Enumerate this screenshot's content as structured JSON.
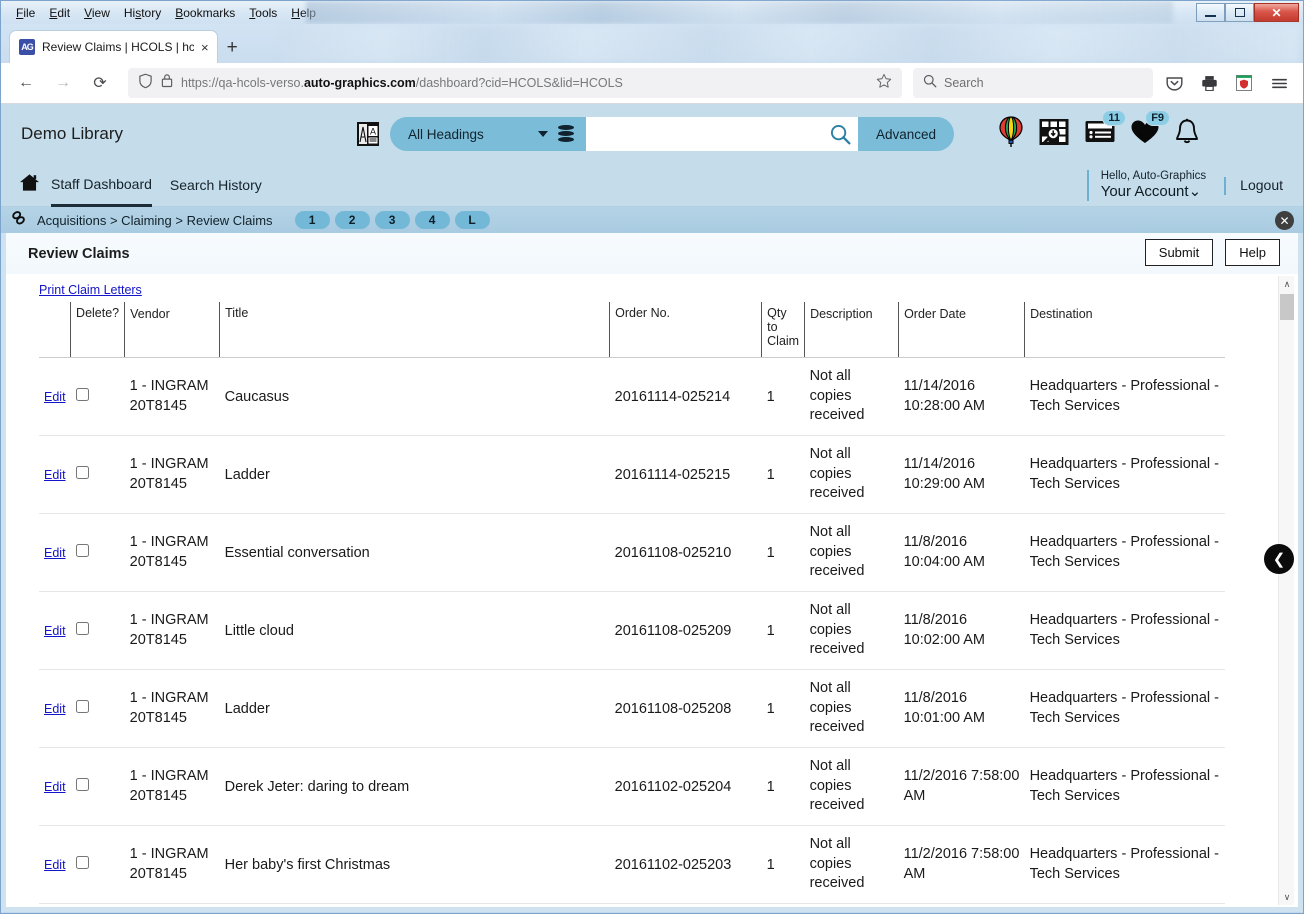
{
  "browser": {
    "menus": [
      "File",
      "Edit",
      "View",
      "History",
      "Bookmarks",
      "Tools",
      "Help"
    ],
    "tab_title": "Review Claims | HCOLS | hcols",
    "tab_close": "×",
    "new_tab": "+",
    "back": "←",
    "forward": "→",
    "reload": "⟳",
    "url_prefix": "https://qa-hcols-verso.",
    "url_domain": "auto-graphics.com",
    "url_suffix": "/dashboard?cid=HCOLS&lid=HCOLS",
    "search_placeholder": "Search",
    "window_close": "✕"
  },
  "app": {
    "library_name": "Demo Library",
    "search": {
      "scope_label": "All Headings",
      "input_value": "",
      "advanced_label": "Advanced"
    },
    "header_icons": [
      {
        "name": "balloon-icon",
        "badge": null
      },
      {
        "name": "visual-search-icon",
        "badge": null
      },
      {
        "name": "lists-icon",
        "badge": "11"
      },
      {
        "name": "favorites-heart-icon",
        "badge": "F9"
      },
      {
        "name": "notifications-bell-icon",
        "badge": null
      }
    ],
    "nav": {
      "links": [
        "Staff Dashboard",
        "Search History"
      ],
      "active": "Staff Dashboard"
    },
    "account": {
      "greeting": "Hello, Auto-Graphics",
      "account_label": "Your Account",
      "logout_label": "Logout"
    },
    "breadcrumb": {
      "text": "Acquisitions > Claiming > Review Claims",
      "pills": [
        "1",
        "2",
        "3",
        "4",
        "L"
      ],
      "close": "✕"
    }
  },
  "work": {
    "page_title": "Review Claims",
    "submit_label": "Submit",
    "help_label": "Help",
    "print_link": "Print Claim Letters",
    "collapse_label": "❮"
  },
  "table": {
    "columns": [
      "",
      "Delete?",
      "Vendor",
      "Title",
      "Order No.",
      "Qty to Claim",
      "Description",
      "Order Date",
      "Destination"
    ],
    "edit_label": "Edit",
    "rows": [
      {
        "vendor": "1 - INGRAM 20T8145",
        "title": "Caucasus",
        "order_no": "20161114-025214",
        "qty": "1",
        "description": "Not all copies received",
        "order_date": "11/14/2016 10:28:00 AM",
        "destination": "Headquarters - Professional - Tech Services",
        "checked": false
      },
      {
        "vendor": "1 - INGRAM 20T8145",
        "title": "Ladder",
        "order_no": "20161114-025215",
        "qty": "1",
        "description": "Not all copies received",
        "order_date": "11/14/2016 10:29:00 AM",
        "destination": "Headquarters - Professional - Tech Services",
        "checked": false
      },
      {
        "vendor": "1 - INGRAM 20T8145",
        "title": "Essential conversation",
        "order_no": "20161108-025210",
        "qty": "1",
        "description": "Not all copies received",
        "order_date": "11/8/2016 10:04:00 AM",
        "destination": "Headquarters - Professional - Tech Services",
        "checked": false
      },
      {
        "vendor": "1 - INGRAM 20T8145",
        "title": "Little cloud",
        "order_no": "20161108-025209",
        "qty": "1",
        "description": "Not all copies received",
        "order_date": "11/8/2016 10:02:00 AM",
        "destination": "Headquarters - Professional - Tech Services",
        "checked": false
      },
      {
        "vendor": "1 - INGRAM 20T8145",
        "title": "Ladder",
        "order_no": "20161108-025208",
        "qty": "1",
        "description": "Not all copies received",
        "order_date": "11/8/2016 10:01:00 AM",
        "destination": "Headquarters - Professional - Tech Services",
        "checked": false
      },
      {
        "vendor": "1 - INGRAM 20T8145",
        "title": "Derek Jeter: daring to dream",
        "order_no": "20161102-025204",
        "qty": "1",
        "description": "Not all copies received",
        "order_date": "11/2/2016 7:58:00 AM",
        "destination": "Headquarters - Professional - Tech Services",
        "checked": false
      },
      {
        "vendor": "1 - INGRAM 20T8145",
        "title": "Her baby's first Christmas",
        "order_no": "20161102-025203",
        "qty": "1",
        "description": "Not all copies received",
        "order_date": "11/2/2016 7:58:00 AM",
        "destination": "Headquarters - Professional - Tech Services",
        "checked": false
      }
    ]
  },
  "colors": {
    "app_header": "#c5dcea",
    "accent": "#7bbcd8",
    "link": "#1414c8"
  }
}
